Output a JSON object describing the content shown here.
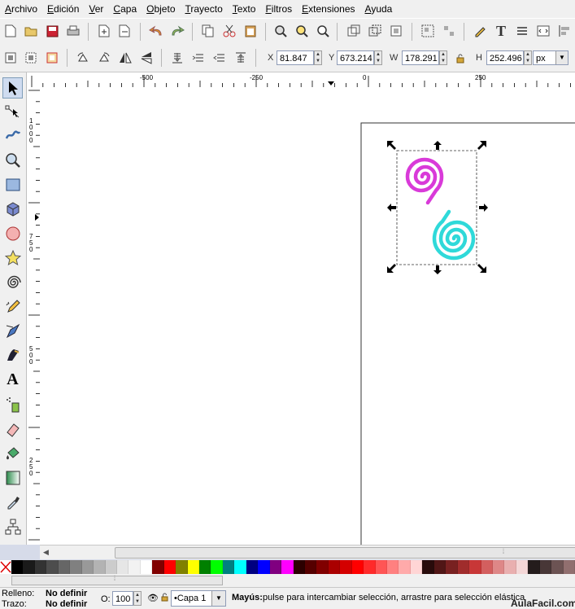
{
  "menu": [
    "Archivo",
    "Edición",
    "Ver",
    "Capa",
    "Objeto",
    "Trayecto",
    "Texto",
    "Filtros",
    "Extensiones",
    "Ayuda"
  ],
  "selection": {
    "x_label": "X",
    "x": "81.847",
    "y_label": "Y",
    "y": "673.214",
    "w_label": "W",
    "w": "178.291",
    "h_label": "H",
    "h": "252.496",
    "unit": "px"
  },
  "ruler": {
    "h_labels": [
      "-500",
      "-250",
      "0",
      "250"
    ],
    "v_labels": [
      "1000",
      "750",
      "500",
      "250"
    ]
  },
  "colors": {
    "spiral_magenta": "#d93ad9",
    "spiral_cyan": "#2fd9d9",
    "palette": [
      "#000000",
      "#1a1a1a",
      "#333333",
      "#4d4d4d",
      "#666666",
      "#808080",
      "#999999",
      "#b3b3b3",
      "#cccccc",
      "#e6e6e6",
      "#f2f2f2",
      "#ffffff",
      "#800000",
      "#ff0000",
      "#808000",
      "#ffff00",
      "#008000",
      "#00ff00",
      "#008080",
      "#00ffff",
      "#000080",
      "#0000ff",
      "#800080",
      "#ff00ff",
      "#2b0000",
      "#550000",
      "#800000",
      "#aa0000",
      "#d40000",
      "#ff0000",
      "#ff2a2a",
      "#ff5555",
      "#ff8080",
      "#ffaaaa",
      "#ffd5d5",
      "#280b0b",
      "#501616",
      "#782121",
      "#a02c2c",
      "#c83737",
      "#d35f5f",
      "#de8787",
      "#e9afaf",
      "#f4d7d7",
      "#241c1c",
      "#483737",
      "#6c5353",
      "#916f6f"
    ]
  },
  "status": {
    "fill_label": "Relleno:",
    "fill_value": "No definir",
    "stroke_label": "Trazo:",
    "stroke_value": "No definir",
    "opacity_label": "O:",
    "opacity": "100",
    "layer": "•Capa 1",
    "hint_bold": "Mayús:",
    "hint": " pulse para intercambiar selección, arrastre para selección elástica",
    "watermark": "AulaFacil.com"
  }
}
